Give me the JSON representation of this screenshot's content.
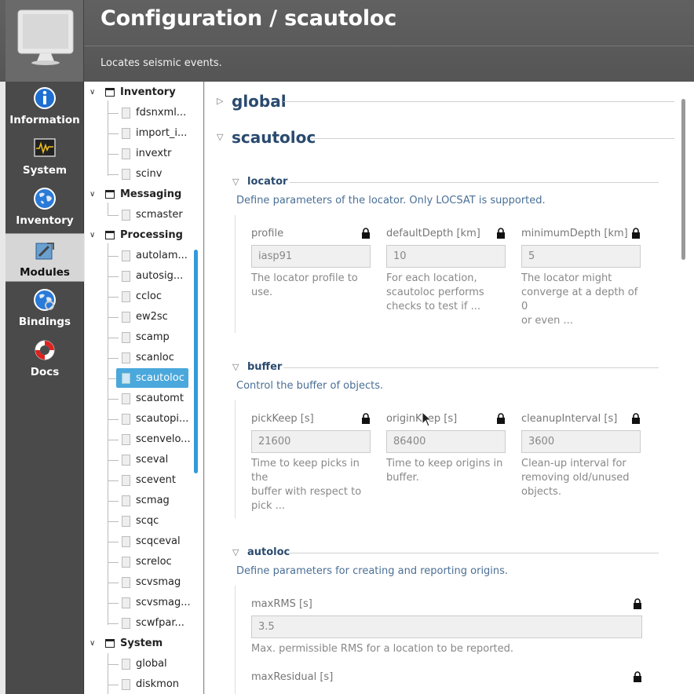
{
  "header": {
    "title": "Configuration / scautoloc",
    "description": "Locates seismic events."
  },
  "nav": [
    {
      "label": "Information",
      "icon": "info-icon"
    },
    {
      "label": "System",
      "icon": "system-monitor-icon"
    },
    {
      "label": "Inventory",
      "icon": "globe-icon"
    },
    {
      "label": "Modules",
      "icon": "modules-icon"
    },
    {
      "label": "Bindings",
      "icon": "bindings-globe-icon"
    },
    {
      "label": "Docs",
      "icon": "lifebuoy-icon"
    }
  ],
  "tree": {
    "inventory": {
      "label": "Inventory",
      "items": [
        "fdsnxml...",
        "import_i...",
        "invextr",
        "scinv"
      ]
    },
    "messaging": {
      "label": "Messaging",
      "items": [
        "scmaster"
      ]
    },
    "processing": {
      "label": "Processing",
      "items": [
        "autolam...",
        "autosig...",
        "ccloc",
        "ew2sc",
        "scamp",
        "scanloc",
        "scautoloc",
        "scautomt",
        "scautopi...",
        "scenvelo...",
        "sceval",
        "scevent",
        "scmag",
        "scqc",
        "scqceval",
        "screloc",
        "scvsmag",
        "scvsmag...",
        "scwfpar..."
      ]
    },
    "system": {
      "label": "System",
      "items": [
        "global",
        "diskmon"
      ]
    }
  },
  "main": {
    "sections": [
      "global",
      "scautoloc"
    ],
    "groups": {
      "locator": {
        "title": "locator",
        "description": "Define parameters of the locator. Only LOCSAT is supported.",
        "params": [
          {
            "label": "profile",
            "value": "iasp91",
            "desc1": "The locator profile to",
            "desc2": "use.",
            "desc3": ""
          },
          {
            "label": "defaultDepth [km]",
            "value": "10",
            "desc1": "For each location,",
            "desc2": "scautoloc performs",
            "desc3": "checks to test if ..."
          },
          {
            "label": "minimumDepth [km]",
            "value": "5",
            "desc1": "The locator might",
            "desc2": "converge at a depth of 0",
            "desc3": "or even ..."
          }
        ]
      },
      "buffer": {
        "title": "buffer",
        "description": "Control the buffer of objects.",
        "params": [
          {
            "label": "pickKeep [s]",
            "value": "21600",
            "desc1": "Time to keep picks in the",
            "desc2": "buffer with respect to",
            "desc3": "pick ..."
          },
          {
            "label": "originKeep [s]",
            "value": "86400",
            "desc1": "Time to keep origins in",
            "desc2": "buffer.",
            "desc3": ""
          },
          {
            "label": "cleanupInterval [s]",
            "value": "3600",
            "desc1": "Clean-up interval for",
            "desc2": "removing old/unused",
            "desc3": "objects."
          }
        ]
      },
      "autoloc": {
        "title": "autoloc",
        "description": "Define parameters for creating and reporting origins.",
        "params": [
          {
            "label": "maxRMS [s]",
            "value": "3.5",
            "desc1": "Max. permissible RMS for a location to be reported."
          },
          {
            "label": "maxResidual [s]"
          }
        ]
      }
    }
  }
}
